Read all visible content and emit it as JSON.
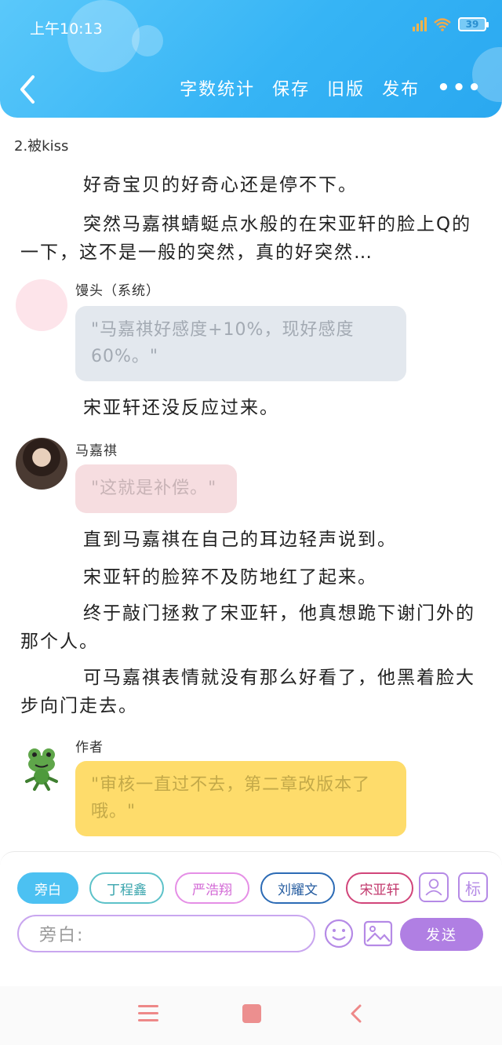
{
  "status": {
    "time": "上午10:13",
    "battery": "39"
  },
  "header": {
    "actions": [
      "字数统计",
      "保存",
      "旧版",
      "发布"
    ],
    "more": "•••"
  },
  "chapter_title": "2.被kiss",
  "paragraphs": {
    "p1": "好奇宝贝的好奇心还是停不下。",
    "p2": "突然马嘉祺蜻蜓点水般的在宋亚轩的脸上Q的一下，这不是一般的突然，真的好突然…",
    "p3": "宋亚轩还没反应过来。",
    "p4": "直到马嘉祺在自己的耳边轻声说到。",
    "p5": "宋亚轩的脸猝不及防地红了起来。",
    "p6": "终于敲门拯救了宋亚轩，他真想跪下谢门外的那个人。",
    "p7": "可马嘉祺表情就没有那么好看了，他黑着脸大步向门走去。"
  },
  "dialogs": {
    "system": {
      "speaker": "馒头（系统）",
      "text": "\"马嘉祺好感度+10%，现好感度60%。\""
    },
    "majiaqi": {
      "speaker": "马嘉祺",
      "text": "\"这就是补偿。\""
    },
    "author": {
      "speaker": "作者",
      "text": "\"审核一直过不去，第二章改版本了哦。\""
    }
  },
  "bottom": {
    "chips": [
      "旁白",
      "丁程鑫",
      "严浩翔",
      "刘耀文",
      "宋亚轩"
    ],
    "tool_label": "标",
    "input_placeholder": "旁白:",
    "send_label": "发送"
  },
  "colors": {
    "header": "#36b4f5",
    "system_bubble": "#e3e8ee",
    "majiaqi_bubble": "#f6dde0",
    "author_bubble": "#fedc6b",
    "send": "#b07fe3"
  }
}
